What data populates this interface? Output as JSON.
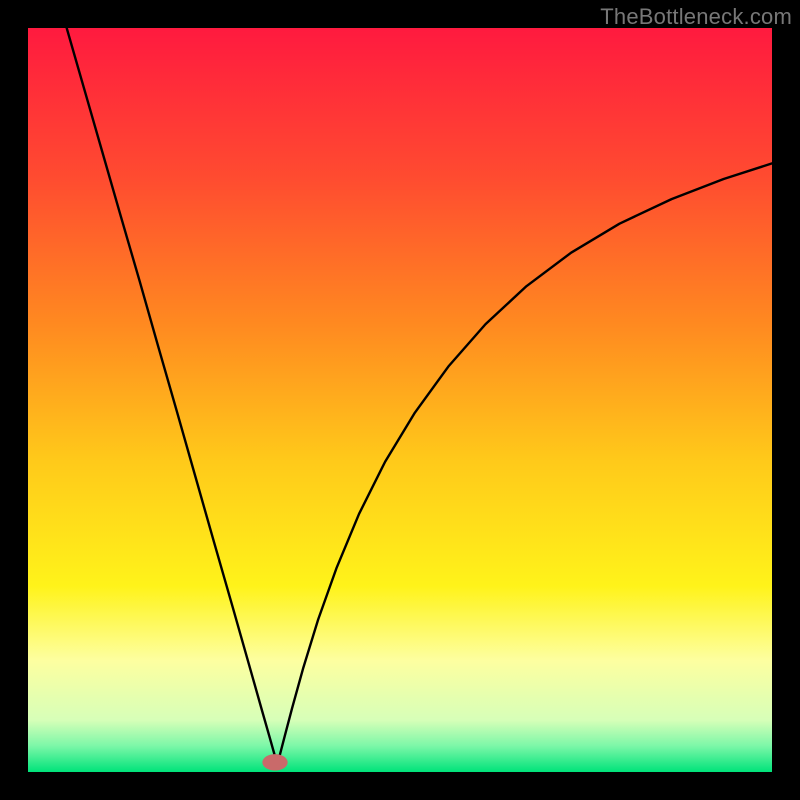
{
  "watermark": "TheBottleneck.com",
  "chart_data": {
    "type": "line",
    "title": "",
    "xlabel": "",
    "ylabel": "",
    "xlim": [
      0,
      1
    ],
    "ylim": [
      0,
      1
    ],
    "grid": false,
    "legend": false,
    "background_gradient_stops": [
      {
        "offset": 0.0,
        "color": "#ff1a3f"
      },
      {
        "offset": 0.2,
        "color": "#ff4b30"
      },
      {
        "offset": 0.4,
        "color": "#ff8a20"
      },
      {
        "offset": 0.58,
        "color": "#ffc91a"
      },
      {
        "offset": 0.75,
        "color": "#fff31a"
      },
      {
        "offset": 0.85,
        "color": "#fdffa0"
      },
      {
        "offset": 0.93,
        "color": "#d7ffb8"
      },
      {
        "offset": 0.965,
        "color": "#7cf7a8"
      },
      {
        "offset": 1.0,
        "color": "#00e37a"
      }
    ],
    "curve_color": "#000000",
    "curve_stroke_width": 2.4,
    "marker": {
      "x": 0.332,
      "y": 0.013,
      "rx": 0.017,
      "ry": 0.011,
      "fill": "#c96a6a"
    },
    "series": [
      {
        "name": "bottleneck-curve",
        "points": [
          {
            "x": 0.052,
            "y": 1.0
          },
          {
            "x": 0.075,
            "y": 0.92
          },
          {
            "x": 0.1,
            "y": 0.833
          },
          {
            "x": 0.125,
            "y": 0.746
          },
          {
            "x": 0.15,
            "y": 0.66
          },
          {
            "x": 0.175,
            "y": 0.572
          },
          {
            "x": 0.2,
            "y": 0.485
          },
          {
            "x": 0.225,
            "y": 0.397
          },
          {
            "x": 0.25,
            "y": 0.309
          },
          {
            "x": 0.275,
            "y": 0.222
          },
          {
            "x": 0.3,
            "y": 0.134
          },
          {
            "x": 0.315,
            "y": 0.081
          },
          {
            "x": 0.325,
            "y": 0.046
          },
          {
            "x": 0.332,
            "y": 0.021
          },
          {
            "x": 0.334,
            "y": 0.015
          },
          {
            "x": 0.338,
            "y": 0.021
          },
          {
            "x": 0.345,
            "y": 0.048
          },
          {
            "x": 0.355,
            "y": 0.086
          },
          {
            "x": 0.37,
            "y": 0.14
          },
          {
            "x": 0.39,
            "y": 0.205
          },
          {
            "x": 0.415,
            "y": 0.275
          },
          {
            "x": 0.445,
            "y": 0.347
          },
          {
            "x": 0.48,
            "y": 0.417
          },
          {
            "x": 0.52,
            "y": 0.483
          },
          {
            "x": 0.565,
            "y": 0.545
          },
          {
            "x": 0.615,
            "y": 0.602
          },
          {
            "x": 0.67,
            "y": 0.653
          },
          {
            "x": 0.73,
            "y": 0.698
          },
          {
            "x": 0.795,
            "y": 0.737
          },
          {
            "x": 0.865,
            "y": 0.77
          },
          {
            "x": 0.935,
            "y": 0.797
          },
          {
            "x": 1.0,
            "y": 0.818
          }
        ]
      }
    ]
  }
}
